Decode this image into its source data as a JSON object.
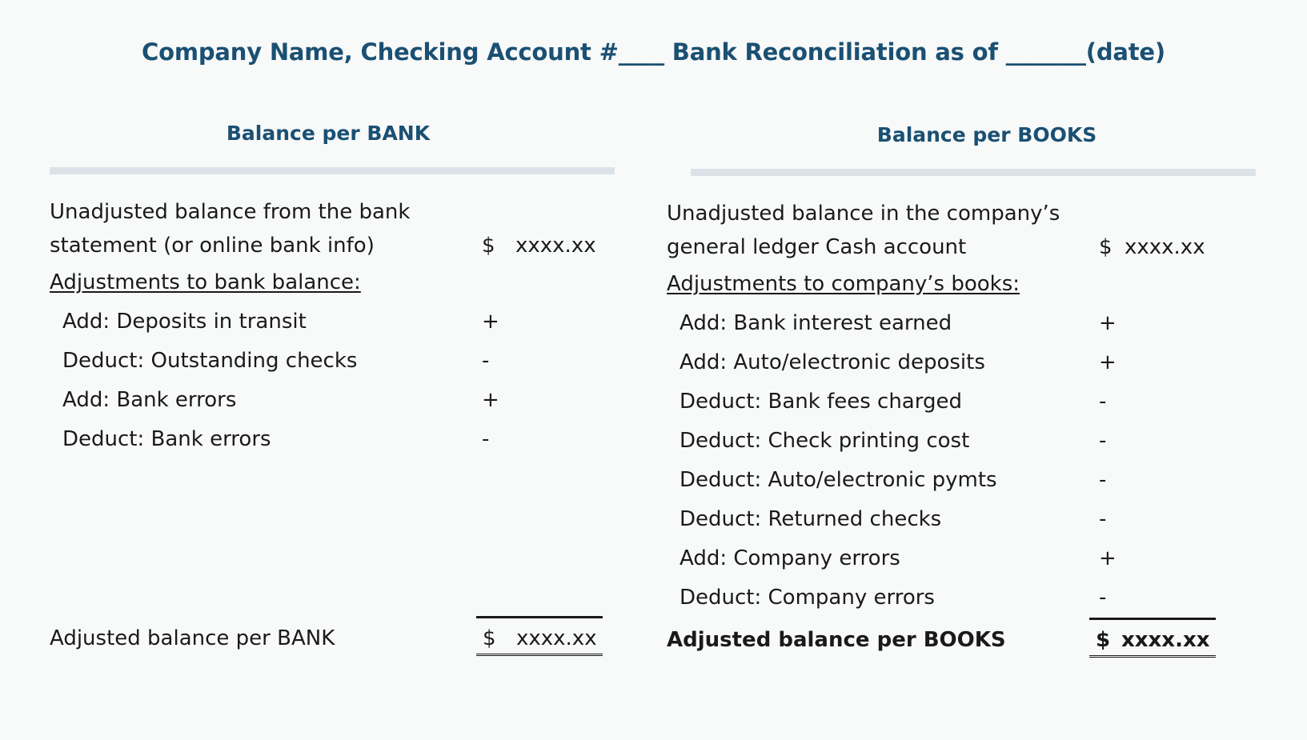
{
  "document": {
    "title": "Company Name, Checking Account #____ Bank Reconciliation as of _______(date)",
    "title_color": "#1a5073",
    "background_color": "#f8f9f9",
    "rule_color": "#dce3e8"
  },
  "bank": {
    "heading": "Balance per BANK",
    "intro": {
      "line1": "Unadjusted balance from the bank",
      "line2": "statement (or online bank info)",
      "currency": "$",
      "amount": "xxxx.xx"
    },
    "adjustments_heading": "Adjustments to bank balance:",
    "adjustments": [
      {
        "label": "Add: Deposits in transit",
        "sign": "+"
      },
      {
        "label": "Deduct: Outstanding checks",
        "sign": "-"
      },
      {
        "label": "Add: Bank errors",
        "sign": "+"
      },
      {
        "label": "Deduct: Bank errors",
        "sign": "-"
      }
    ],
    "total": {
      "label": "Adjusted balance per BANK",
      "currency": "$",
      "amount": "xxxx.xx"
    }
  },
  "books": {
    "heading": "Balance per BOOKS",
    "intro": {
      "line1": "Unadjusted balance in the company’s",
      "line2": "general ledger Cash account",
      "currency": "$",
      "amount": "xxxx.xx"
    },
    "adjustments_heading": "Adjustments to company’s books:",
    "adjustments": [
      {
        "label": "Add: Bank interest earned",
        "sign": "+"
      },
      {
        "label": "Add: Auto/electronic deposits",
        "sign": "+"
      },
      {
        "label": "Deduct: Bank fees charged",
        "sign": "-"
      },
      {
        "label": "Deduct: Check printing cost",
        "sign": "-"
      },
      {
        "label": "Deduct: Auto/electronic pymts",
        "sign": "-"
      },
      {
        "label": "Deduct: Returned checks",
        "sign": "-"
      },
      {
        "label": "Add: Company errors",
        "sign": "+"
      },
      {
        "label": "Deduct: Company errors",
        "sign": "-"
      }
    ],
    "total": {
      "label": "Adjusted balance per BOOKS",
      "currency": "$",
      "amount": "xxxx.xx"
    }
  }
}
